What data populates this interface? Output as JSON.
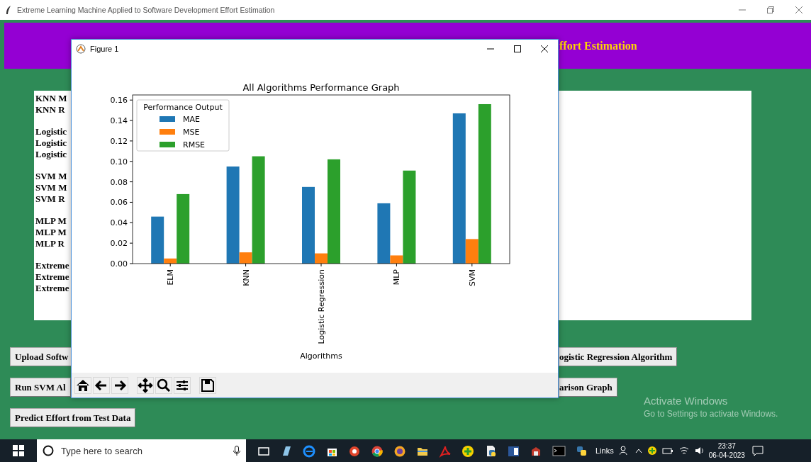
{
  "app_window": {
    "title": "Extreme Learning Machine Applied to Software Development Effort Estimation"
  },
  "header": {
    "title": "ffort Estimation"
  },
  "results_text": {
    "groups": [
      [
        "KNN M",
        "KNN R"
      ],
      [
        "Logistic",
        "Logistic",
        "Logistic"
      ],
      [
        "SVM M",
        "SVM M",
        "SVM R"
      ],
      [
        "MLP M",
        "MLP M",
        "MLP R"
      ],
      [
        "Extreme",
        "Extreme",
        "Extreme"
      ]
    ]
  },
  "button_rows": [
    {
      "buttons": [
        {
          "kind": "button",
          "label": "Upload Softw"
        },
        {
          "kind": "button",
          "label": "ogistic Regression Algorithm"
        }
      ]
    },
    {
      "buttons": [
        {
          "kind": "button",
          "label": "Run SVM Al"
        },
        {
          "kind": "button",
          "label": "arison Graph"
        }
      ]
    },
    {
      "buttons": [
        {
          "kind": "button",
          "label": "Predict Effort from Test Data"
        }
      ]
    }
  ],
  "figure": {
    "title": "Figure 1",
    "chart_data": {
      "type": "bar",
      "title": "All Algorithms Performance Graph",
      "xlabel": "Algorithms",
      "legend": {
        "title": "Performance Output"
      },
      "categories": [
        "ELM",
        "KNN",
        "Logistic Regression",
        "MLP",
        "SVM"
      ],
      "series": [
        {
          "name": "MAE",
          "color": "#1f77b4",
          "values": [
            0.046,
            0.095,
            0.075,
            0.059,
            0.147
          ]
        },
        {
          "name": "MSE",
          "color": "#ff7f0e",
          "values": [
            0.005,
            0.011,
            0.01,
            0.008,
            0.024
          ]
        },
        {
          "name": "RMSE",
          "color": "#2ca02c",
          "values": [
            0.068,
            0.105,
            0.102,
            0.091,
            0.156
          ]
        }
      ],
      "ylim": [
        0,
        0.165
      ],
      "yticks": [
        {
          "value": 0,
          "label": "0.00"
        },
        {
          "value": 0.02,
          "label": "0.02"
        },
        {
          "value": 0.04,
          "label": "0.04"
        },
        {
          "value": 0.06,
          "label": "0.06"
        },
        {
          "value": 0.08,
          "label": "0.08"
        },
        {
          "value": 0.1,
          "label": "0.10"
        },
        {
          "value": 0.12,
          "label": "0.12"
        },
        {
          "value": 0.14,
          "label": "0.14"
        },
        {
          "value": 0.16,
          "label": "0.16"
        }
      ]
    }
  },
  "system_notice": {
    "title": "Activate Windows",
    "text": "Go to Settings to activate Windows."
  },
  "taskbar": {
    "search": {
      "placeholder": "Type here to search"
    },
    "links_label": "Links",
    "time": "23:37",
    "date": "06-04-2023"
  }
}
